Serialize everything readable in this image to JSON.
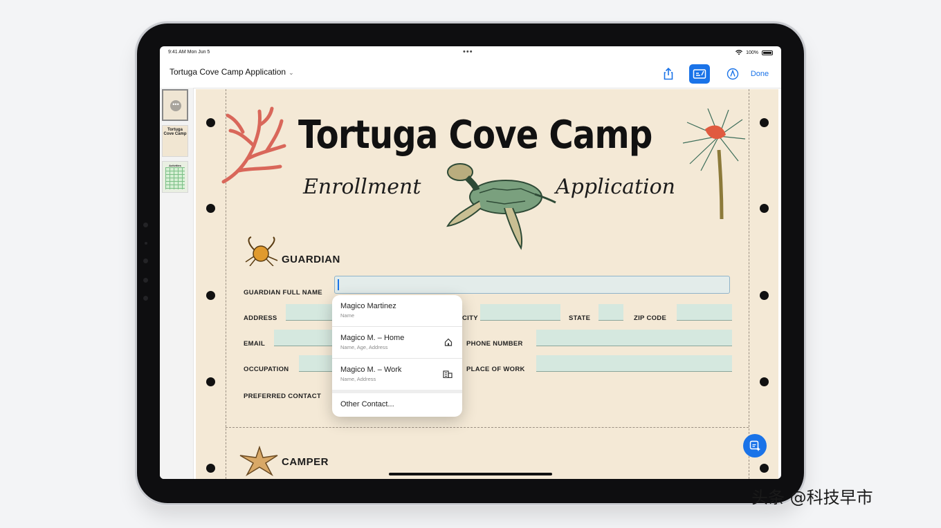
{
  "status_bar": {
    "time": "9:41 AM  Mon Jun 5",
    "dots": "•••",
    "battery": "100%"
  },
  "toolbar": {
    "doc_title": "Tortuga Cove Camp Application",
    "title_chevron": "⌄",
    "done_label": "Done"
  },
  "thumbnails": [
    {
      "label": "",
      "more": "•••"
    },
    {
      "label": "Tortuga Cove Camp"
    },
    {
      "label": "Activities"
    }
  ],
  "form": {
    "title": "Tortuga Cove Camp",
    "subtitle_left": "Enrollment",
    "subtitle_right": "Application",
    "guardian_section": "GUARDIAN",
    "camper_section": "CAMPER",
    "labels": {
      "guardian_full_name": "GUARDIAN FULL NAME",
      "address": "ADDRESS",
      "city": "CITY",
      "state": "STATE",
      "zip_code": "ZIP CODE",
      "email": "EMAIL",
      "phone_number": "PHONE NUMBER",
      "occupation": "OCCUPATION",
      "place_of_work": "PLACE OF WORK",
      "preferred_contact": "PREFERRED CONTACT"
    }
  },
  "autofill": {
    "items": [
      {
        "name": "Magico Martinez",
        "sub": "Name",
        "icon": ""
      },
      {
        "name": "Magico M. – Home",
        "sub": "Name, Age, Address",
        "icon": "house-icon"
      },
      {
        "name": "Magico M. – Work",
        "sub": "Name, Address",
        "icon": "building-icon"
      }
    ],
    "other_contact": "Other Contact..."
  },
  "watermark": "头条 @科技早市",
  "colors": {
    "accent": "#1a73e8",
    "paper": "#f4e9d6",
    "field": "#d5e8df"
  }
}
